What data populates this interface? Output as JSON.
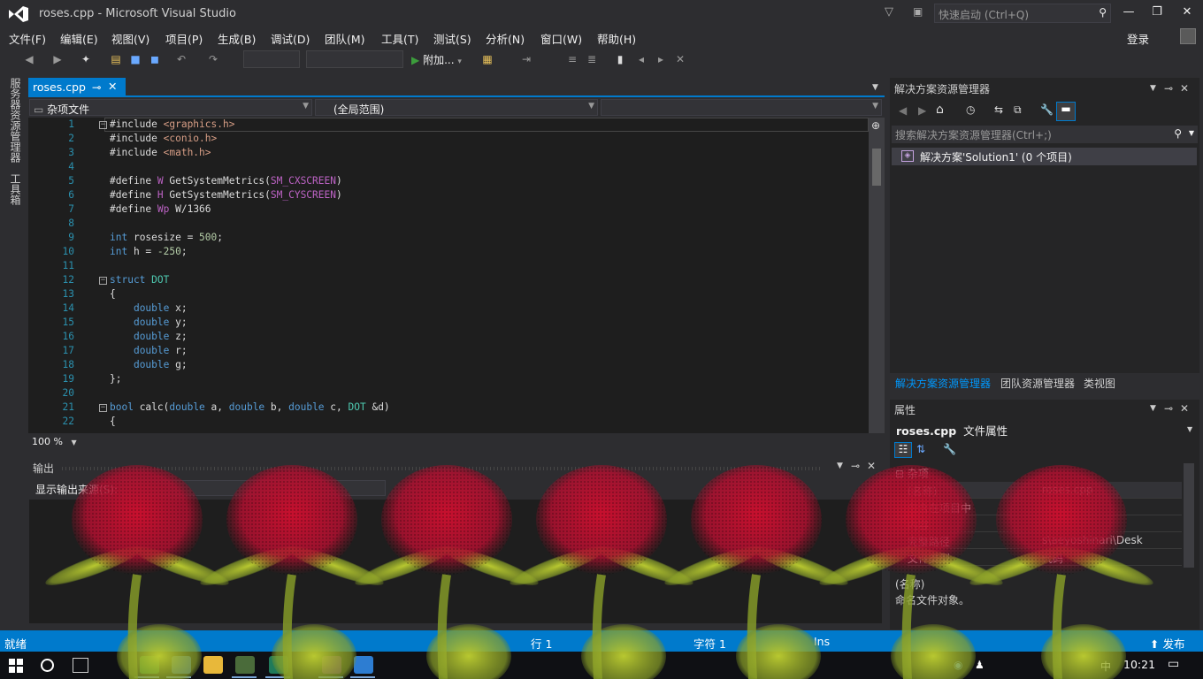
{
  "window": {
    "title": "roses.cpp - Microsoft Visual Studio",
    "quick_launch_placeholder": "快速启动 (Ctrl+Q)",
    "login": "登录"
  },
  "menu": [
    "文件(F)",
    "编辑(E)",
    "视图(V)",
    "项目(P)",
    "生成(B)",
    "调试(D)",
    "团队(M)",
    "工具(T)",
    "测试(S)",
    "分析(N)",
    "窗口(W)",
    "帮助(H)"
  ],
  "toolbar": {
    "attach_label": "附加...",
    "attach_arrow": "▾"
  },
  "left_rail": {
    "server_explorer": "服务器资源管理器",
    "toolbox": "工具箱"
  },
  "editor": {
    "tab_label": "roses.cpp",
    "nav_project": "杂项文件",
    "nav_scope": "(全局范围)",
    "zoom": "100 %",
    "lines": [
      {
        "n": "1",
        "tokens": [
          [
            "",
            "#include "
          ],
          [
            "s",
            "<graphics.h>"
          ]
        ]
      },
      {
        "n": "2",
        "tokens": [
          [
            "",
            "#include "
          ],
          [
            "s",
            "<conio.h>"
          ]
        ]
      },
      {
        "n": "3",
        "tokens": [
          [
            "",
            "#include "
          ],
          [
            "s",
            "<math.h>"
          ]
        ]
      },
      {
        "n": "4",
        "tokens": []
      },
      {
        "n": "5",
        "tokens": [
          [
            "",
            "#define "
          ],
          [
            "m",
            "W"
          ],
          [
            "",
            " GetSystemMetrics("
          ],
          [
            "m",
            "SM_CXSCREEN"
          ],
          [
            "",
            ")"
          ]
        ]
      },
      {
        "n": "6",
        "tokens": [
          [
            "",
            "#define "
          ],
          [
            "m",
            "H"
          ],
          [
            "",
            " GetSystemMetrics("
          ],
          [
            "m",
            "SM_CYSCREEN"
          ],
          [
            "",
            ")"
          ]
        ]
      },
      {
        "n": "7",
        "tokens": [
          [
            "",
            "#define "
          ],
          [
            "m",
            "Wp"
          ],
          [
            "",
            " W/1366"
          ]
        ]
      },
      {
        "n": "8",
        "tokens": []
      },
      {
        "n": "9",
        "tokens": [
          [
            "k",
            "int"
          ],
          [
            "",
            " rosesize = "
          ],
          [
            "n",
            "500"
          ],
          [
            "",
            ";"
          ]
        ]
      },
      {
        "n": "10",
        "tokens": [
          [
            "k",
            "int"
          ],
          [
            "",
            " h = "
          ],
          [
            "n",
            "-250"
          ],
          [
            "",
            ";"
          ]
        ]
      },
      {
        "n": "11",
        "tokens": []
      },
      {
        "n": "12",
        "tokens": [
          [
            "k",
            "struct"
          ],
          [
            "",
            " "
          ],
          [
            "t",
            "DOT"
          ]
        ]
      },
      {
        "n": "13",
        "tokens": [
          [
            "",
            "{"
          ]
        ]
      },
      {
        "n": "14",
        "tokens": [
          [
            "",
            "    "
          ],
          [
            "k",
            "double"
          ],
          [
            "",
            " x;"
          ]
        ]
      },
      {
        "n": "15",
        "tokens": [
          [
            "",
            "    "
          ],
          [
            "k",
            "double"
          ],
          [
            "",
            " y;"
          ]
        ]
      },
      {
        "n": "16",
        "tokens": [
          [
            "",
            "    "
          ],
          [
            "k",
            "double"
          ],
          [
            "",
            " z;"
          ]
        ]
      },
      {
        "n": "17",
        "tokens": [
          [
            "",
            "    "
          ],
          [
            "k",
            "double"
          ],
          [
            "",
            " r;"
          ]
        ]
      },
      {
        "n": "18",
        "tokens": [
          [
            "",
            "    "
          ],
          [
            "k",
            "double"
          ],
          [
            "",
            " g;"
          ]
        ]
      },
      {
        "n": "19",
        "tokens": [
          [
            "",
            "};"
          ]
        ]
      },
      {
        "n": "20",
        "tokens": []
      },
      {
        "n": "21",
        "tokens": [
          [
            "k",
            "bool"
          ],
          [
            "",
            " calc("
          ],
          [
            "k",
            "double"
          ],
          [
            "",
            " a, "
          ],
          [
            "k",
            "double"
          ],
          [
            "",
            " b, "
          ],
          [
            "k",
            "double"
          ],
          [
            "",
            " c, "
          ],
          [
            "t",
            "DOT"
          ],
          [
            "",
            " &d)"
          ]
        ]
      },
      {
        "n": "22",
        "tokens": [
          [
            "",
            "{"
          ]
        ]
      }
    ]
  },
  "output": {
    "title": "输出",
    "source_label": "显示输出来源(S):"
  },
  "solution_explorer": {
    "title": "解决方案资源管理器",
    "search_placeholder": "搜索解决方案资源管理器(Ctrl+;)",
    "solution_item": "解决方案'Solution1' (0 个项目)",
    "tabs": [
      "解决方案资源管理器",
      "团队资源管理器",
      "类视图"
    ]
  },
  "properties": {
    "title": "属性",
    "object_name": "roses.cpp",
    "object_type": "文件属性",
    "category": "杂项",
    "rows": [
      {
        "name": "(名称)",
        "value": "roses.cpp"
      },
      {
        "name": "包含在项目中",
        "value": ""
      },
      {
        "name": "内容",
        "value": ""
      },
      {
        "name": "完整路径",
        "value": "s\\aeyoshinari\\Desk"
      },
      {
        "name": "文件类型",
        "value": "代码"
      }
    ],
    "desc_title": "(名称)",
    "desc_text": "命名文件对象。"
  },
  "statusbar": {
    "ready": "就绪",
    "line": "行 1",
    "char": "字符 1",
    "ins": "Ins",
    "publish": "发布"
  },
  "taskbar": {
    "time": "10:21",
    "ime": "中"
  }
}
